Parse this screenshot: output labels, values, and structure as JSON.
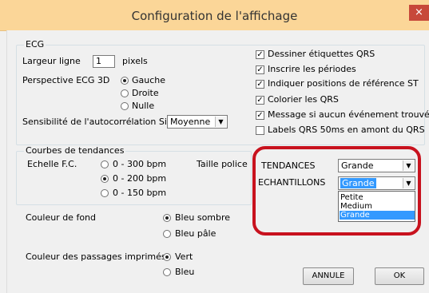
{
  "window": {
    "title": "Configuration de l'affichage",
    "close_glyph": "×"
  },
  "ecg": {
    "legend": "ECG",
    "line_width_label": "Largeur ligne",
    "line_width_value": "1",
    "line_width_unit": "pixels",
    "perspective_label": "Perspective ECG 3D",
    "perspective_options": [
      "Gauche",
      "Droite",
      "Nulle"
    ],
    "perspective_selected": "Gauche",
    "sigma_label": "Sensibilité de l'autocorrélation Sigma",
    "sigma_value": "Moyenne",
    "checkboxes": [
      {
        "label": "Dessiner étiquettes QRS",
        "checked": true
      },
      {
        "label": "Inscrire les périodes",
        "checked": true
      },
      {
        "label": "Indiquer positions de référence ST",
        "checked": true
      },
      {
        "label": "Colorier les QRS",
        "checked": true
      },
      {
        "label": "Message si aucun événement trouvé",
        "checked": true
      },
      {
        "label": "Labels QRS 50ms en amont du QRS",
        "checked": false
      }
    ]
  },
  "trends": {
    "legend": "Courbes de tendances",
    "hr_scale_label": "Echelle F.C.",
    "hr_options": [
      "0 - 300 bpm",
      "0 - 200 bpm",
      "0 - 150 bpm"
    ],
    "hr_selected": "0 - 200 bpm",
    "font_size_label": "Taille police",
    "tendances_label": "TENDANCES",
    "tendances_value": "Grande",
    "echantillons_label": "ECHANTILLONS",
    "echantillons_value": "Grande",
    "dropdown_options": [
      "Petite",
      "Medium",
      "Grande"
    ],
    "dropdown_highlighted": "Grande"
  },
  "background": {
    "label": "Couleur de fond",
    "options": [
      "Bleu sombre",
      "Bleu pâle"
    ],
    "selected": "Bleu sombre"
  },
  "printed": {
    "label": "Couleur des passages imprimés",
    "options": [
      "Vert",
      "Bleu"
    ],
    "selected": "Vert"
  },
  "buttons": {
    "cancel": "ANNULE",
    "ok": "OK"
  },
  "colors": {
    "highlight_box": "#c8121e",
    "selection": "#3399ff",
    "titlebar": "#fbd698"
  },
  "icons": {
    "close": "close-icon",
    "dropdown_arrow": "chevron-down-icon",
    "check": "check-icon"
  }
}
